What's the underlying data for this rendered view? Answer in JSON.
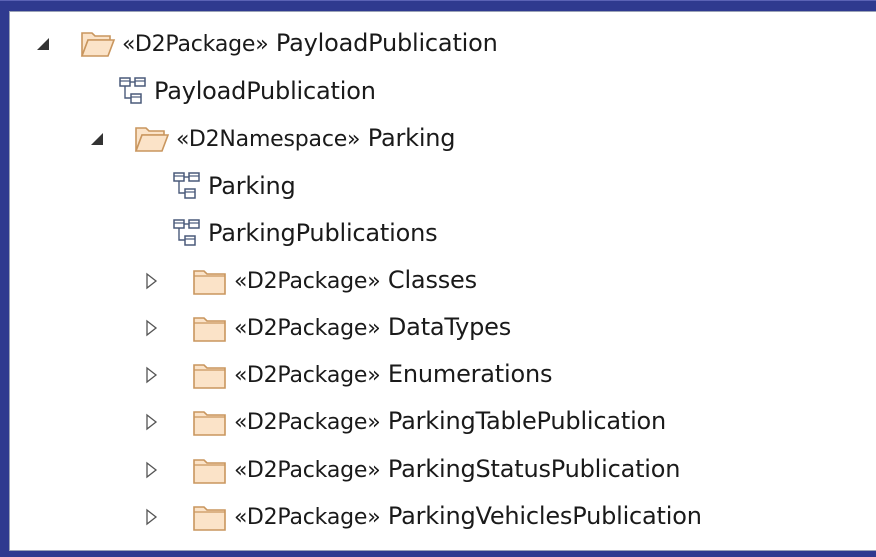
{
  "tree": {
    "items": [
      {
        "stereotype": "«D2Package»",
        "name": "PayloadPublication",
        "icon": "folder-open-icon",
        "expander": "expanded",
        "depth": 0
      },
      {
        "stereotype": "",
        "name": "PayloadPublication",
        "icon": "class-diagram-icon",
        "expander": "none",
        "depth": 1
      },
      {
        "stereotype": "«D2Namespace»",
        "name": "Parking",
        "icon": "folder-open-icon",
        "expander": "expanded",
        "depth": 1
      },
      {
        "stereotype": "",
        "name": "Parking",
        "icon": "class-diagram-icon",
        "expander": "none",
        "depth": 2
      },
      {
        "stereotype": "",
        "name": "ParkingPublications",
        "icon": "class-diagram-icon",
        "expander": "none",
        "depth": 2
      },
      {
        "stereotype": "«D2Package»",
        "name": "Classes",
        "icon": "folder-closed-icon",
        "expander": "collapsed",
        "depth": 2
      },
      {
        "stereotype": "«D2Package»",
        "name": "DataTypes",
        "icon": "folder-closed-icon",
        "expander": "collapsed",
        "depth": 2
      },
      {
        "stereotype": "«D2Package»",
        "name": "Enumerations",
        "icon": "folder-closed-icon",
        "expander": "collapsed",
        "depth": 2
      },
      {
        "stereotype": "«D2Package»",
        "name": "ParkingTablePublication",
        "icon": "folder-closed-icon",
        "expander": "collapsed",
        "depth": 2
      },
      {
        "stereotype": "«D2Package»",
        "name": "ParkingStatusPublication",
        "icon": "folder-closed-icon",
        "expander": "collapsed",
        "depth": 2
      },
      {
        "stereotype": "«D2Package»",
        "name": "ParkingVehiclesPublication",
        "icon": "folder-closed-icon",
        "expander": "collapsed",
        "depth": 2
      }
    ]
  },
  "colors": {
    "background": "#2f3a8f",
    "panel": "#ffffff",
    "folder_fill": "#fbe3c8",
    "folder_stroke": "#c9965e",
    "diagram_stroke": "#4a5a7a",
    "text": "#1a1a1a"
  }
}
